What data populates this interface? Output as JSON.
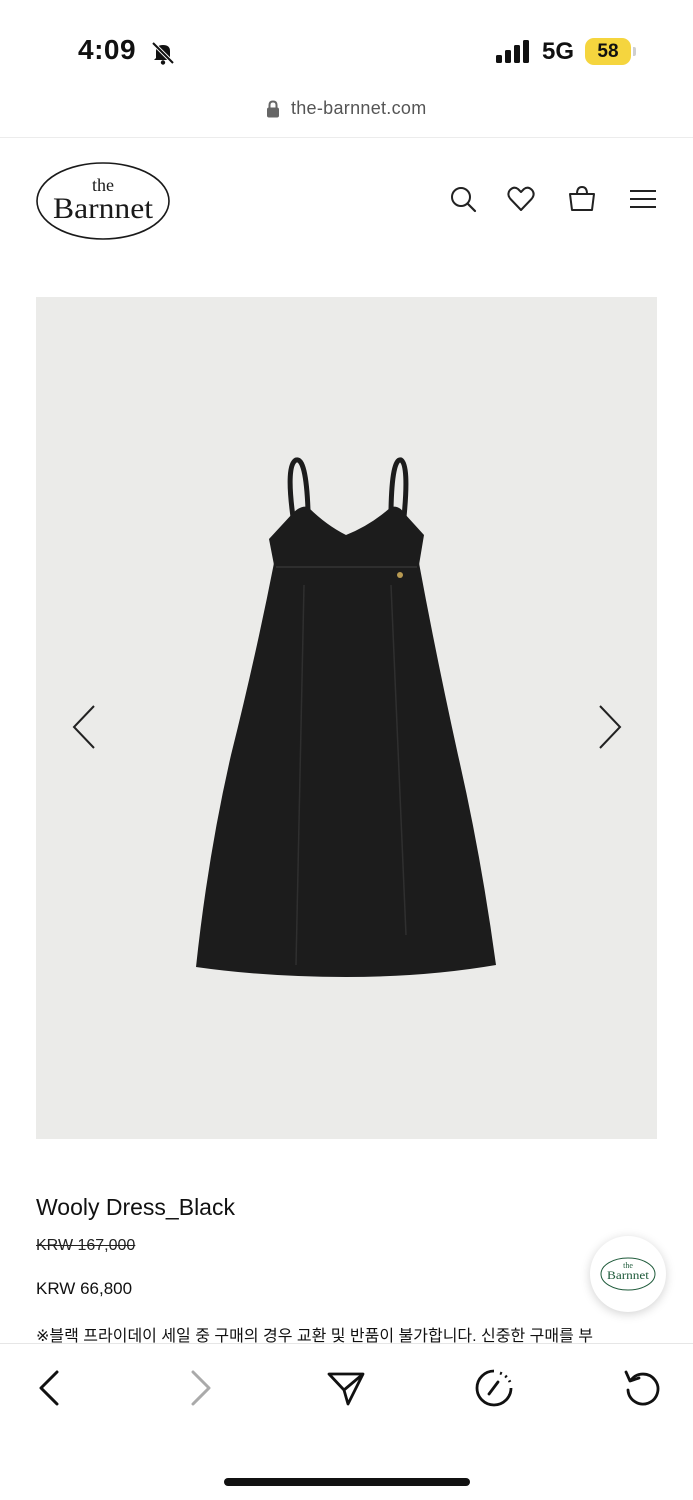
{
  "status_bar": {
    "time": "4:09",
    "network": "5G",
    "battery": "58",
    "battery_color": "#f5d53e"
  },
  "browser": {
    "url": "the-barnnet.com"
  },
  "site": {
    "logo_top": "the",
    "logo_main": "Barnnet",
    "logo_color": "#1a1a1a",
    "icons": [
      "search-icon",
      "heart-icon",
      "shopping-bag-icon",
      "menu-icon"
    ]
  },
  "product": {
    "name": "Wooly Dress_Black",
    "original_price": "KRW 167,000",
    "sale_price": "KRW 66,800",
    "notice": "※블랙 프라이데이 세일 중 구매의 경우 교환 및 반품이 불가합니다. 신중한 구매를 부",
    "image_background": "#ebebe9",
    "dress_color": "#1c1c1c"
  },
  "chat_widget": {
    "logo_top": "the",
    "logo_main": "Barnnet",
    "logo_color": "#1e5a3a"
  },
  "toolbar": {
    "icons": [
      "back-icon",
      "forward-icon",
      "share-icon",
      "speed-icon",
      "reload-icon"
    ]
  }
}
